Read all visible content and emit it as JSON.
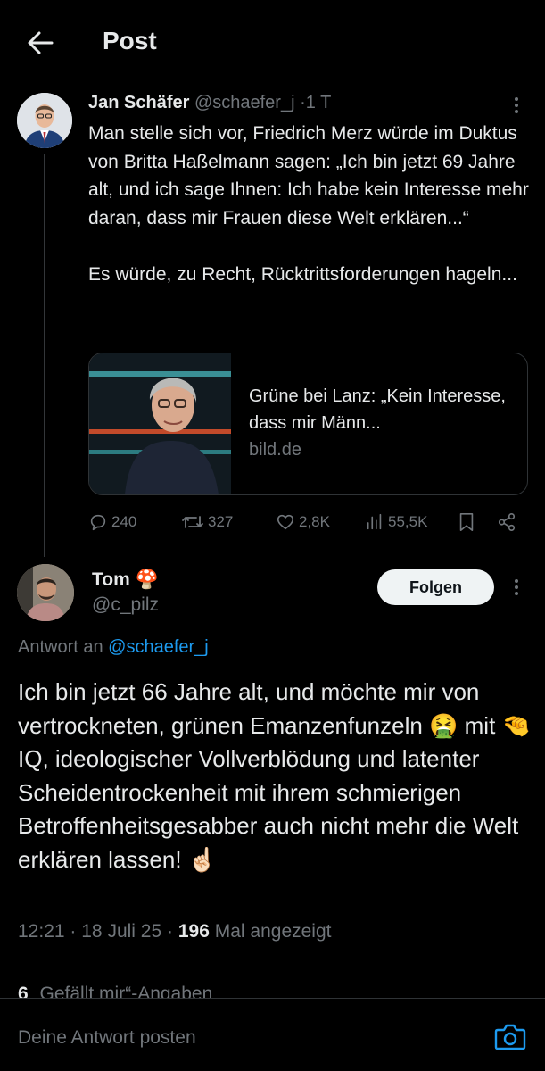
{
  "header": {
    "title": "Post",
    "back_icon": "arrow-left-icon"
  },
  "tweet1": {
    "name": "Jan Schäfer",
    "handle": "@schaefer_j",
    "separator": "·",
    "time": "1 T",
    "body_p1": "Man stelle sich vor, Friedrich Merz würde im Duktus von Britta Haßelmann sagen: „Ich bin jetzt 69 Jahre alt, und ich sage Ihnen: Ich habe kein Interesse mehr daran, dass mir Frauen diese Welt erklären...“",
    "body_p2": "Es würde, zu Recht, Rücktrittsforderungen hageln...",
    "card": {
      "title": "Grüne bei Lanz: „Kein Interesse, dass mir Männ...",
      "domain": "bild.de"
    },
    "actions": {
      "replies": "240",
      "reposts": "327",
      "likes": "2,8K",
      "views": "55,5K"
    }
  },
  "tweet2": {
    "name": "Tom",
    "name_emoji": "🍄",
    "handle": "@c_pilz",
    "follow_label": "Folgen",
    "reply_to_prefix": "Antwort an",
    "reply_to_handle": "@schaefer_j",
    "body": "Ich bin jetzt 66 Jahre alt, und möchte mir von vertrockneten, grünen Emanzenfunzeln 🤮 mit 🤏 IQ, ideologischer Vollverblödung und latenter Scheidentrockenheit mit ihrem schmierigen Betroffenheitsgesabber auch nicht mehr die Welt erklären lassen! ☝🏻",
    "time": "12:21",
    "dot": "·",
    "date": "18 Juli 25",
    "views": "196",
    "views_label": "Mal angezeigt",
    "likes_count": "6",
    "likes_label": "„Gefällt mir“-Angaben"
  },
  "compose": {
    "placeholder": "Deine Antwort posten"
  },
  "colors": {
    "background": "#000000",
    "text": "#e7e9ea",
    "muted": "#71767b",
    "accent": "#1d9bf0"
  }
}
